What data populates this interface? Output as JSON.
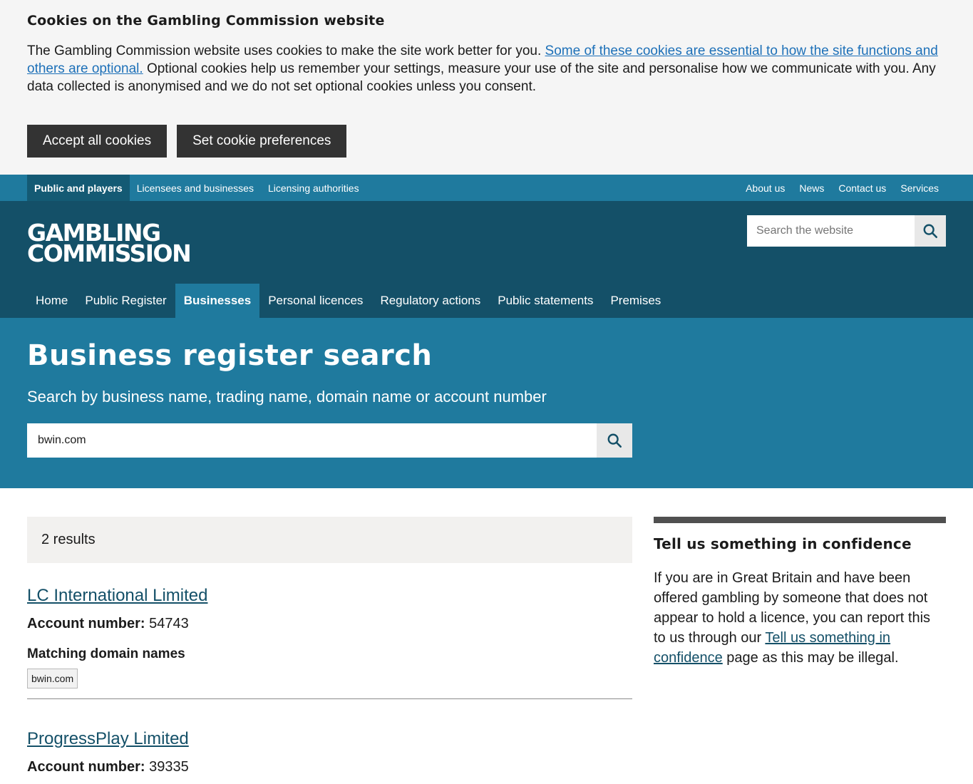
{
  "cookie": {
    "title": "Cookies on the Gambling Commission website",
    "text_before": "The Gambling Commission website uses cookies to make the site work better for you. ",
    "link_text": "Some of these cookies are essential to how the site functions and others are optional.",
    "text_after": " Optional cookies help us remember your settings, measure your use of the site and personalise how we communicate with you. Any data collected is anonymised and we do not set optional cookies unless you consent.",
    "accept_label": "Accept all cookies",
    "prefs_label": "Set cookie preferences"
  },
  "utility": {
    "left": [
      "Public and players",
      "Licensees and businesses",
      "Licensing authorities"
    ],
    "right": [
      "About us",
      "News",
      "Contact us",
      "Services"
    ]
  },
  "header": {
    "logo_line1": "GAMBLING",
    "logo_line2": "COMMISSION",
    "search_placeholder": "Search the website"
  },
  "mainnav": [
    "Home",
    "Public Register",
    "Businesses",
    "Personal licences",
    "Regulatory actions",
    "Public statements",
    "Premises"
  ],
  "hero": {
    "title": "Business register search",
    "subtitle": "Search by business name, trading name, domain name or account number",
    "search_value": "bwin.com"
  },
  "results": {
    "count": "2 results",
    "account_label": "Account number:",
    "matching_label": "Matching domain names",
    "items": [
      {
        "name": "LC International Limited",
        "account": "54743",
        "domain": "bwin.com"
      },
      {
        "name": "ProgressPlay Limited",
        "account": "39335"
      }
    ]
  },
  "aside": {
    "title": "Tell us something in confidence",
    "text_before": "If you are in Great Britain and have been offered gambling by someone that does not appear to hold a licence, you can report this to us through our ",
    "link_text": "Tell us something in confidence",
    "text_after": " page as this may be illegal."
  },
  "colors": {
    "utility_bar": "#1f7a9e",
    "header": "#145068",
    "hero": "#1f7a9e",
    "link": "#1d70b8"
  }
}
